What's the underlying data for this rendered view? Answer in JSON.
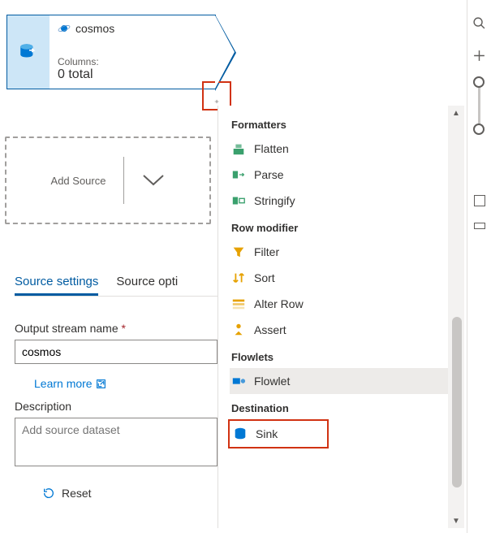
{
  "node": {
    "title": "cosmos",
    "columns_label": "Columns:",
    "columns_value": "0 total",
    "icon": "db-export-icon",
    "title_icon": "cosmos-icon"
  },
  "plus_handle_glyph": "⊹",
  "add_source": {
    "label": "Add Source"
  },
  "tabs": [
    {
      "label": "Source settings",
      "active": true
    },
    {
      "label": "Source opti"
    }
  ],
  "form": {
    "output_label": "Output stream name",
    "output_value": "cosmos",
    "learn_more": "Learn more",
    "description_label": "Description",
    "description_placeholder": "Add source dataset",
    "reset_label": "Reset"
  },
  "popup": {
    "groups": [
      {
        "header": "Formatters",
        "items": [
          {
            "icon": "flatten-icon",
            "label": "Flatten",
            "color": "#3aa06d"
          },
          {
            "icon": "parse-icon",
            "label": "Parse",
            "color": "#3aa06d"
          },
          {
            "icon": "stringify-icon",
            "label": "Stringify",
            "color": "#3aa06d"
          }
        ]
      },
      {
        "header": "Row modifier",
        "items": [
          {
            "icon": "filter-icon",
            "label": "Filter",
            "color": "#e6a100"
          },
          {
            "icon": "sort-icon",
            "label": "Sort",
            "color": "#e6a100"
          },
          {
            "icon": "alterrow-icon",
            "label": "Alter Row",
            "color": "#e6a100"
          },
          {
            "icon": "assert-icon",
            "label": "Assert",
            "color": "#e6a100"
          }
        ]
      },
      {
        "header": "Flowlets",
        "items": [
          {
            "icon": "flowlet-icon",
            "label": "Flowlet",
            "color": "#0078d4",
            "hover": true
          }
        ]
      },
      {
        "header": "Destination",
        "items": [
          {
            "icon": "sink-icon",
            "label": "Sink",
            "color": "#0078d4",
            "highlight": true
          }
        ]
      }
    ]
  },
  "rail": {
    "search": "search-icon",
    "add": "plus-icon"
  }
}
